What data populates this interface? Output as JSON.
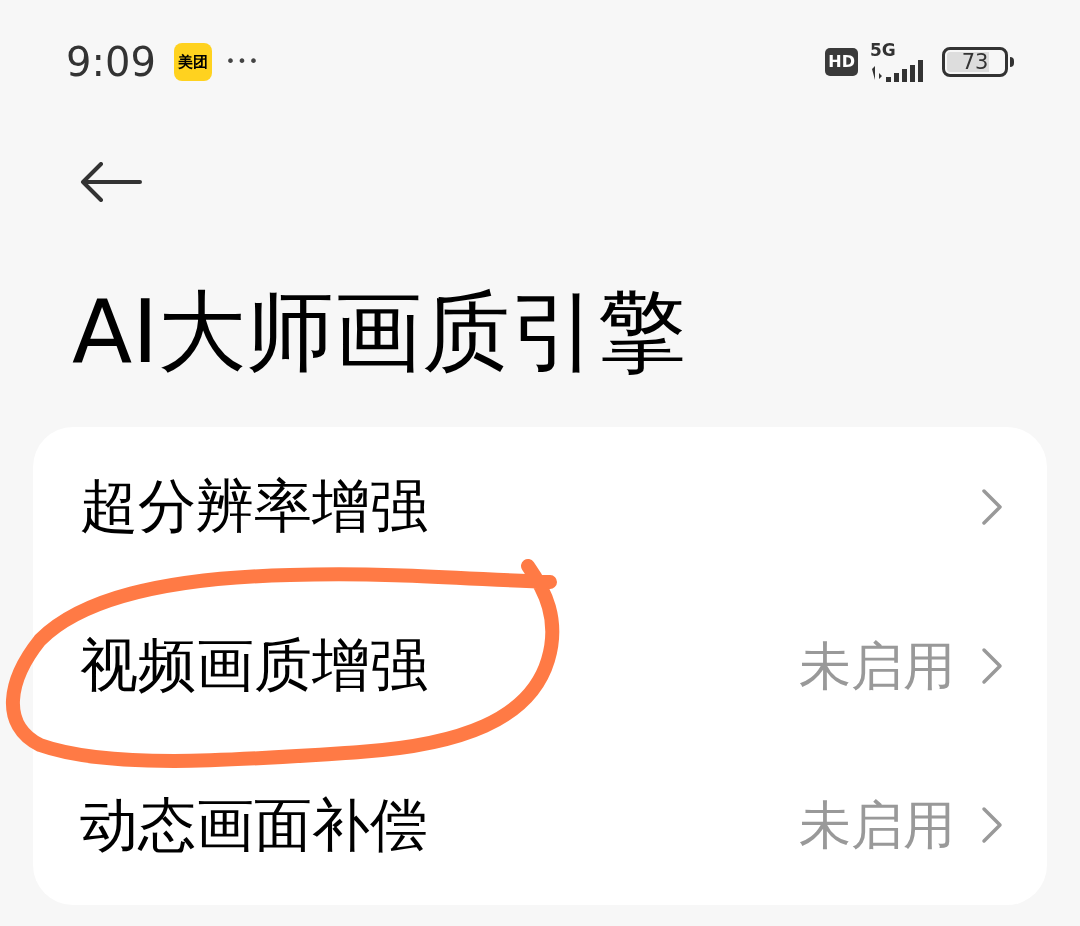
{
  "status_bar": {
    "time": "9:09",
    "app_badge": "美团",
    "more": "•••",
    "hd": "HD",
    "network": "5G",
    "battery": "73"
  },
  "title": "AI大师画质引擎",
  "rows": [
    {
      "label": "超分辨率增强"
    },
    {
      "label": "视频画质增强",
      "value": "未启用"
    },
    {
      "label": "动态画面补偿",
      "value": "未启用"
    }
  ]
}
